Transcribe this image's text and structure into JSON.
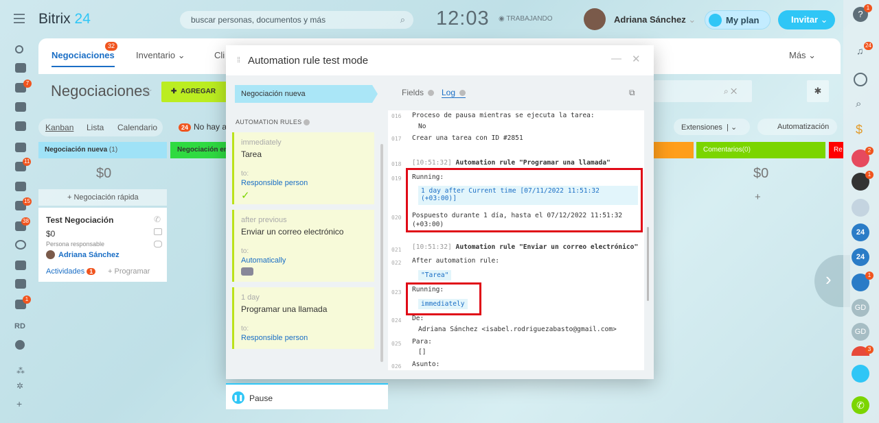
{
  "header": {
    "logo_main": "Bitrix",
    "logo_num": "24",
    "search_placeholder": "buscar personas, documentos y más",
    "time": "12:03",
    "status": "TRABAJANDO",
    "user": "Adriana Sánchez",
    "myplan": "My plan",
    "invite": "Invitar"
  },
  "tabs": [
    {
      "label": "Negociaciones",
      "badge": "32"
    },
    {
      "label": "Inventario"
    },
    {
      "label": "Cli"
    }
  ],
  "tab_more": "Más",
  "page": {
    "title": "Negociaciones",
    "add": "AGREGAR",
    "views": [
      "Kanban",
      "Lista",
      "Calendario"
    ],
    "no_hay": "No hay a",
    "no_hay_badge": "24"
  },
  "stages": {
    "s1": "Negociación nueva",
    "s1_count": "(1)",
    "s2": "Negociación en",
    "com": "Comentarios",
    "com_count": "(0)",
    "red": "Re"
  },
  "kanban": {
    "sum": "$0",
    "quick": "+ Negociación rápida",
    "plus": "+"
  },
  "deal": {
    "title": "Test Negociación",
    "price": "$0",
    "resp_label": "Persona responsable",
    "resp_name": "Adriana Sánchez",
    "activities": "Actividades",
    "activities_badge": "1",
    "program": "+ Programar"
  },
  "toolbar": {
    "extensions": "Extensiones",
    "automation": "Automatización"
  },
  "modal": {
    "title": "Automation rule test mode",
    "stage": "Negociación nueva",
    "rules_title": "AUTOMATION RULES",
    "pause": "Pause",
    "tab_fields": "Fields",
    "tab_log": "Log",
    "rules": [
      {
        "when": "immediately",
        "name": "Tarea",
        "to": "to:",
        "target": "Responsible person"
      },
      {
        "when": "after previous",
        "name": "Enviar un correo electrónico",
        "to": "to:",
        "target": "Automatically"
      },
      {
        "when": "1 day",
        "name": "Programar una llamada",
        "to": "to:",
        "target": "Responsible person"
      }
    ]
  },
  "log": [
    {
      "n": "016",
      "t": "Proceso de pausa mientras se ejecuta la tarea:"
    },
    {
      "n": "",
      "t": "  No"
    },
    {
      "n": "017",
      "t": "Crear una tarea con ID #2851"
    },
    {
      "n": "018",
      "ts": "[10:51:32]",
      "t": " Automation rule \"Programar una llamada\""
    },
    {
      "n": "019",
      "t": "Running:"
    },
    {
      "n": "",
      "hl": "1 day after Current time [07/11/2022 11:51:32"
    },
    {
      "n": "",
      "hl2": "(+03:00)]"
    },
    {
      "n": "020",
      "t": "Pospuesto durante 1 día, hasta el 07/12/2022 11:51:32"
    },
    {
      "n": "",
      "t": "(+03:00)"
    },
    {
      "n": "021",
      "ts": "[10:51:32]",
      "t": " Automation rule \"Enviar un correo electrónico\""
    },
    {
      "n": "022",
      "t": "After automation rule:"
    },
    {
      "n": "",
      "hl": "\"Tarea\""
    },
    {
      "n": "023",
      "t": "Running:"
    },
    {
      "n": "",
      "hl": "immediately"
    },
    {
      "n": "024",
      "t": "De:"
    },
    {
      "n": "",
      "t": "  Adriana Sánchez <isabel.rodriguezabasto@gmail.com>"
    },
    {
      "n": "025",
      "t": "Para:"
    },
    {
      "n": "",
      "t": "  []"
    },
    {
      "n": "026",
      "t": "Asunto:"
    }
  ],
  "leftbar_badges": {
    "b1": "7",
    "b2": "11",
    "b3": "15",
    "b4": "38",
    "b5": "1",
    "rd": "RD"
  },
  "rightbar_badges": {
    "help": "1",
    "bell": "24",
    "r1": "2",
    "r2": "1",
    "r3": "1",
    "r4": "3",
    "gd": "GD"
  },
  "colors": {
    "accent": "#2fc6f6",
    "green": "#bbed21",
    "highlight": "#e00a17"
  }
}
